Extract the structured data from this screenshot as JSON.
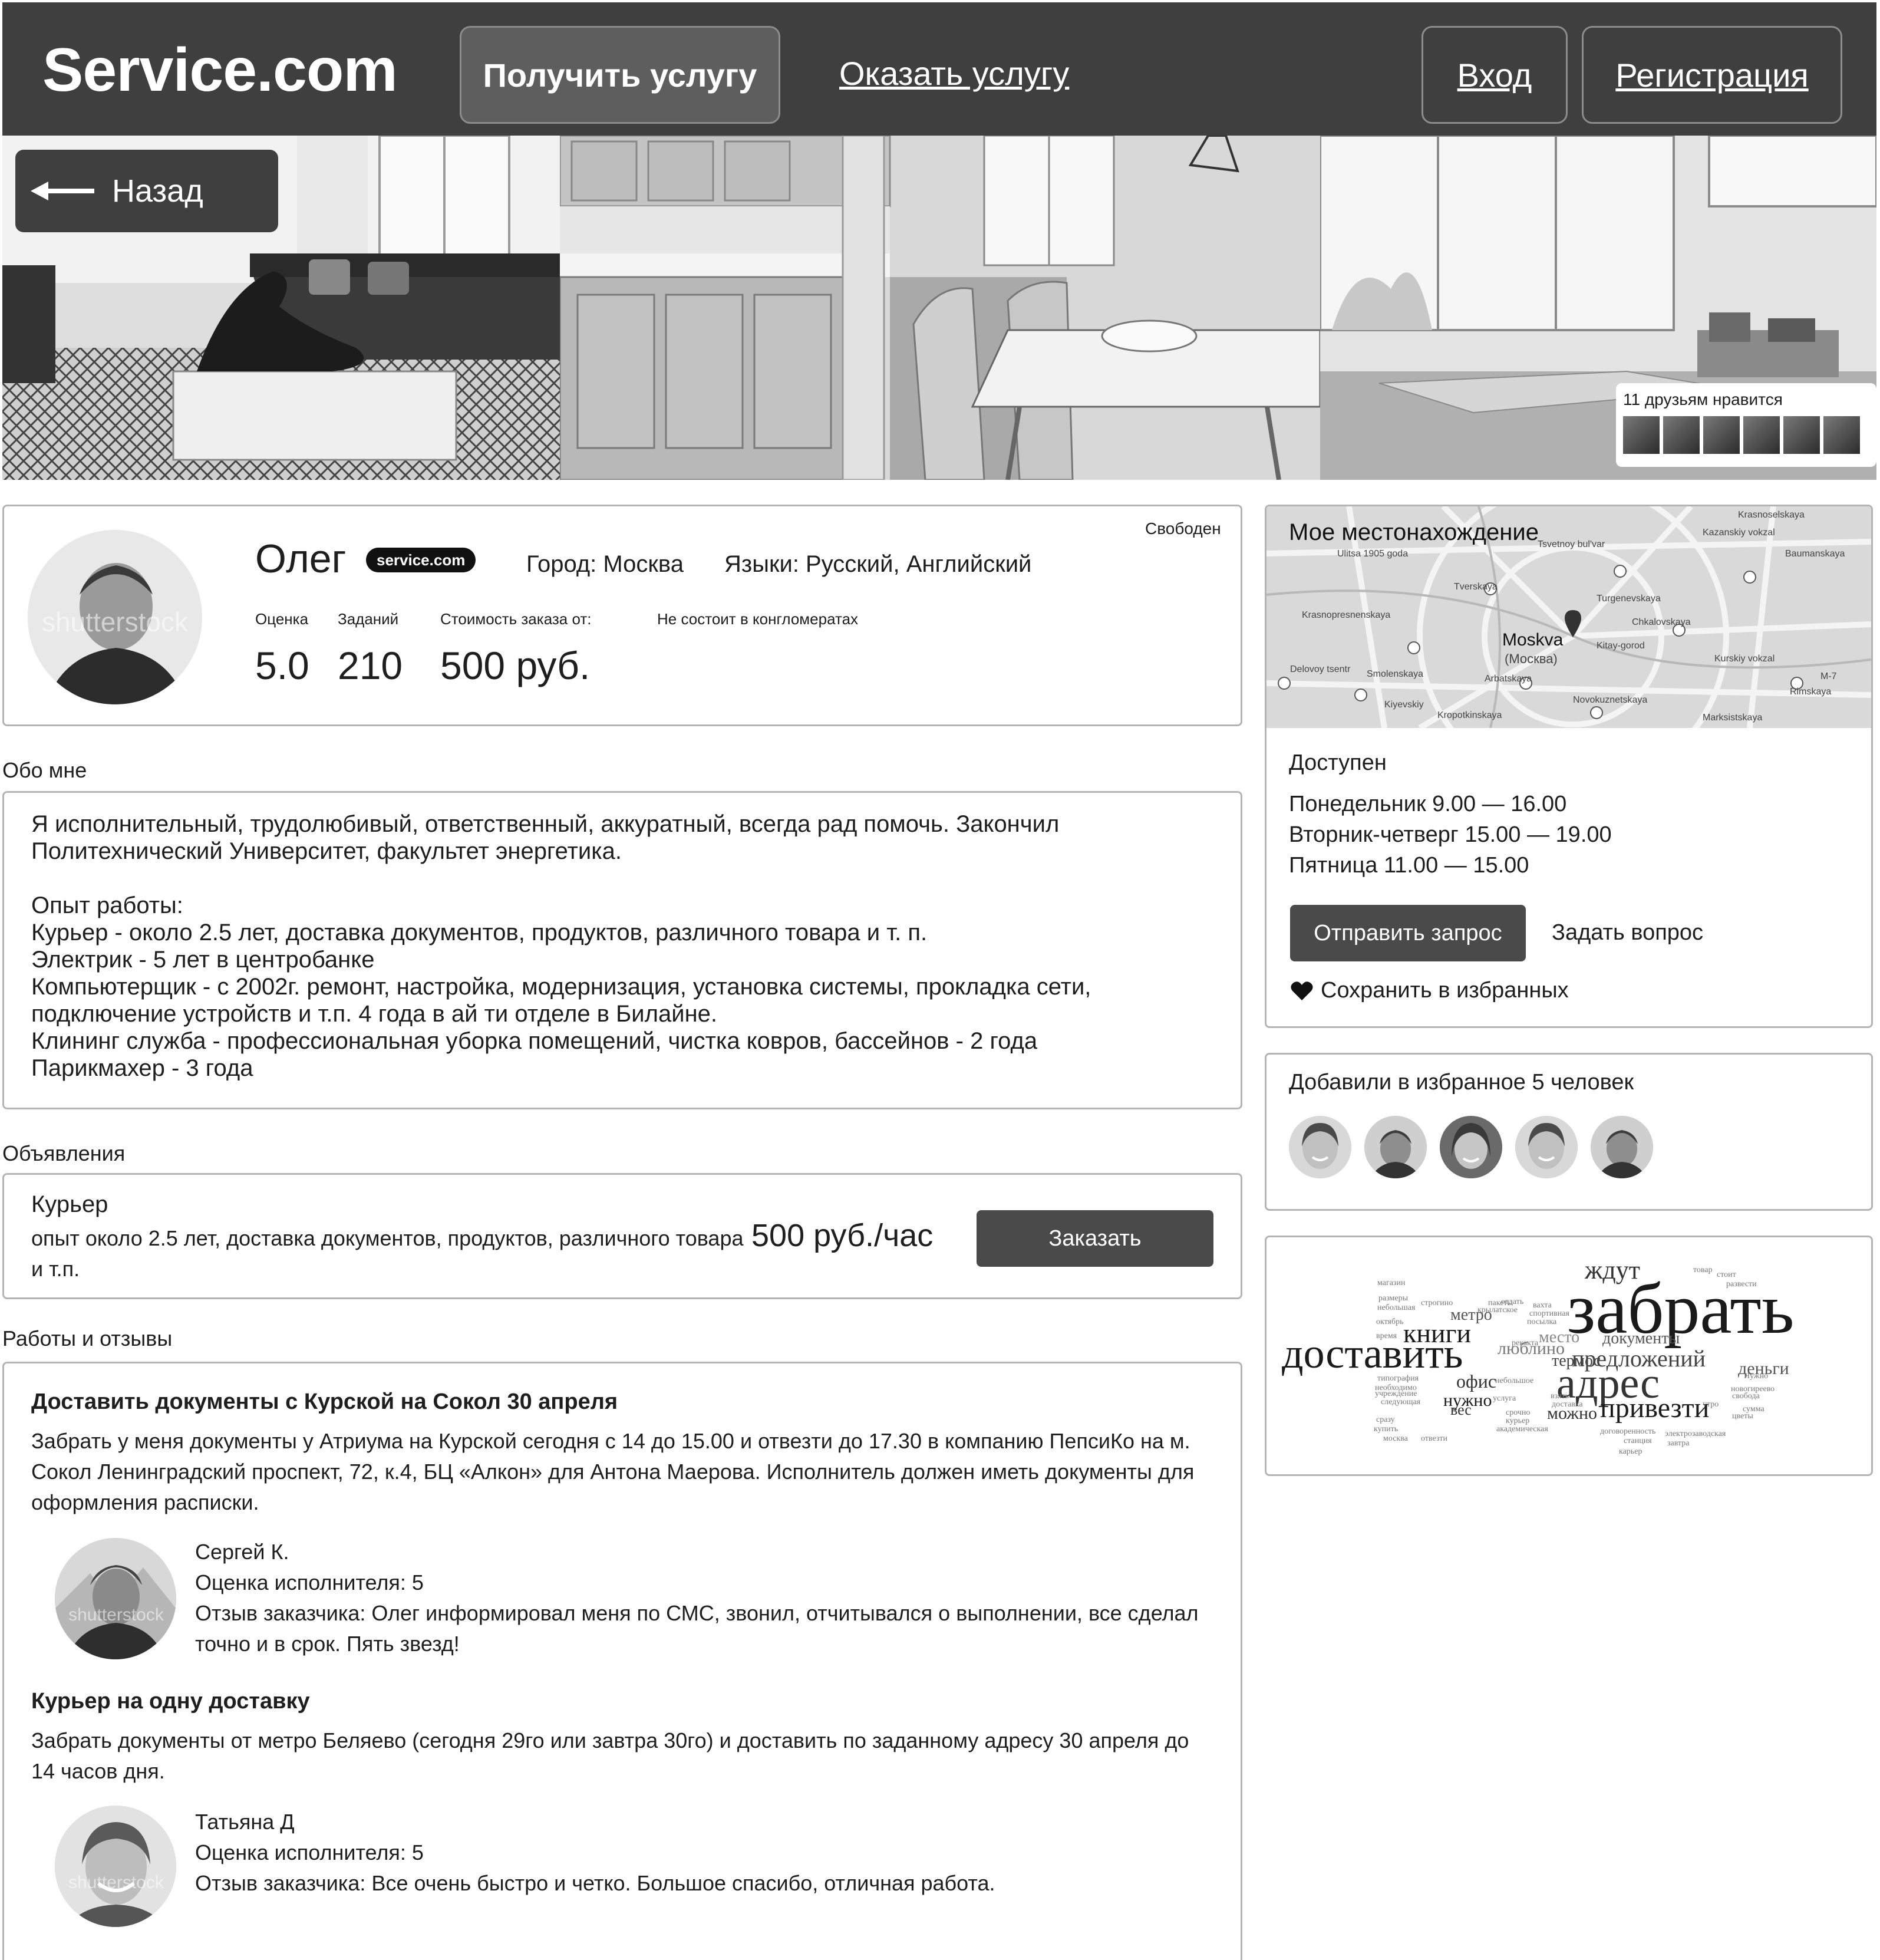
{
  "header": {
    "logo": "Service.com",
    "get_service": "Получить услугу",
    "offer_service": "Оказать услугу",
    "login": "Вход",
    "register": "Регистрация"
  },
  "hero": {
    "back": "Назад",
    "friends_like": "11 друзьям нравится"
  },
  "profile": {
    "name": "Олег",
    "badge": "service.com",
    "city": "Город: Москва",
    "languages": "Языки: Русский, Английский",
    "status": "Свободен",
    "avatar_watermark": "shutterstock",
    "stats": {
      "rating_label": "Оценка",
      "tasks_label": "Заданий",
      "price_label": "Стоимость заказа от:",
      "conglomerate": "Не состоит в конгломератах",
      "rating": "5.0",
      "tasks": "210",
      "price": "500 руб."
    }
  },
  "about": {
    "label": "Обо мне",
    "text": "Я исполнительный, трудолюбивый, ответственный, аккуратный, всегда рад помочь. Закончил\nПолитехнический Университет, факультет энергетика.\n\nОпыт работы:\nКурьер - около 2.5 лет, доставка документов, продуктов, различного товара и т. п.\nЭлектрик - 5 лет в центробанке\nКомпьютерщик - с 2002г. ремонт, настройка, модернизация, установка системы, прокладка сети,\nподключение устройств и т.п. 4 года в ай ти отделе в Билайне.\nКлининг служба - профессиональная уборка помещений, чистка ковров, бассейнов - 2 года\nПарикмахер - 3 года"
  },
  "ads": {
    "label": "Объявления",
    "title": "Курьер",
    "desc": "опыт около 2.5 лет, доставка документов, продуктов, различного товара и т.п.",
    "price": "500 руб./час",
    "order": "Заказать"
  },
  "reviews": {
    "label": "Работы и отзывы",
    "items": [
      {
        "title": "Доставить документы с Курской на Сокол 30 апреля",
        "text": "Забрать у меня документы у Атриума на Курской сегодня с 14 до 15.00 и отвезти до 17.30 в компанию ПепсиКо на м. Сокол Ленинградский проспект, 72, к.4, БЦ «Алкон» для Антона Маерова. Исполнитель должен иметь документы для оформления расписки.",
        "author": "Сергей К.",
        "rating": "Оценка исполнителя: 5",
        "feedback": "Отзыв заказчика: Олег информировал меня по СМС, звонил, отчитывался о выполнении, все сделал точно и в срок. Пять звезд!",
        "watermark": "shutterstock"
      },
      {
        "title": "Курьер на одну доставку",
        "text": "Забрать документы от метро Беляево (сегодня 29го или завтра 30го) и доставить по заданному адресу 30 апреля до 14 часов дня.",
        "author": "Татьяна Д",
        "rating": "Оценка исполнителя: 5",
        "feedback": "Отзыв заказчика: Все очень быстро и четко. Большое спасибо, отличная работа.",
        "watermark": "shutterstock"
      }
    ]
  },
  "sidebar": {
    "map_title": "Мое местонахождение",
    "map_city": "Moskva",
    "map_city_local": "(Москва)",
    "map_streets": [
      "Tverskaya",
      "Kazanskiy vokzal",
      "Krasnopresnenskaya",
      "Smolenskaya",
      "Arbatskaya",
      "Kitay-gorod",
      "Kurskiy vokzal",
      "Turgenevskaya",
      "Chkalovskaya",
      "Novokuznetskaya",
      "Kropotkinskaya",
      "Baumanskaya",
      "Rimskaya",
      "Delovoy tsentr",
      "Kiyevskiy",
      "Ulitsa 1905 goda",
      "Marksistskaya",
      "Krasnoselskaya",
      "Tsvetnoy bul'var",
      "M-7"
    ],
    "available_title": "Доступен",
    "schedule": [
      "Понедельник  9.00 — 16.00",
      "Вторник-четверг   15.00 — 19.00",
      "Пятница   11.00 —  15.00"
    ],
    "send_request": "Отправить запрос",
    "ask_question": "Задать вопрос",
    "save_favorite": "Сохранить в избранных",
    "favs_title": "Добавили в избранное 5 человек"
  },
  "word_cloud": {
    "main": [
      "забрать",
      "доставить",
      "адрес",
      "привезти",
      "книги",
      "предложений",
      "ждут",
      "метро",
      "офис",
      "нужно",
      "термос",
      "люблино",
      "место",
      "документы",
      "деньги",
      "можно",
      "вес"
    ],
    "small": [
      "магазин",
      "размеры",
      "небольшая",
      "строгино",
      "октябрь",
      "отдать",
      "вахта",
      "посылка",
      "спортивная",
      "крылатское",
      "рекакта",
      "типография",
      "учреждение",
      "следующая",
      "сразу",
      "купить",
      "москва",
      "отвезти",
      "услуга",
      "академическая",
      "пакеты",
      "курьер",
      "договоренность",
      "станция",
      "утро",
      "свобода",
      "сумма",
      "завтра",
      "новогиреево",
      "электрозаводская",
      "небольшое",
      "карьер",
      "стоит",
      "развести",
      "товар",
      "время",
      "необходимо",
      "цветы",
      "взять",
      "доставка",
      "срочно",
      "Нужно"
    ]
  },
  "colors": {
    "header_bg": "#3f3f3f",
    "nav_active_bg": "#5e5e5e",
    "button_bg": "#4a4a4a",
    "border": "#b4b4b4",
    "text": "#1e1e1e"
  }
}
